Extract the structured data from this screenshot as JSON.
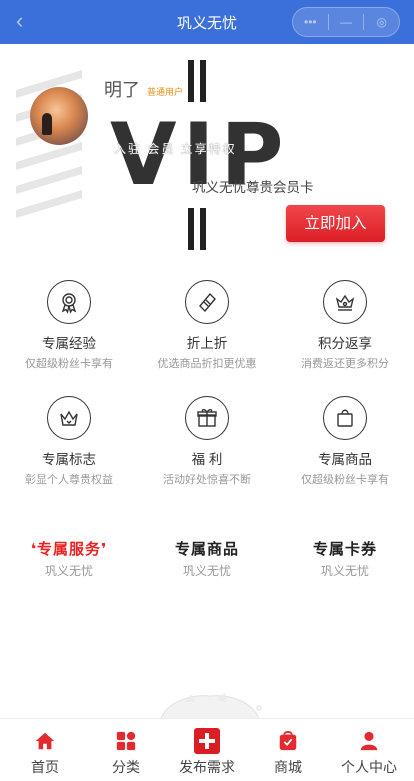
{
  "header": {
    "title": "巩义无忧"
  },
  "member": {
    "name": "明了",
    "level": "普通用户",
    "ghost_text": "入驻  会员  立享特权",
    "vip_text": "VIP",
    "card_name": "巩义无忧尊贵会员卡",
    "join_label": "立即加入"
  },
  "perks": [
    {
      "title": "专属经验",
      "desc": "仅超级粉丝卡享有",
      "icon": "medal-icon"
    },
    {
      "title": "折上折",
      "desc": "优选商品折扣更优惠",
      "icon": "ticket-icon"
    },
    {
      "title": "积分返享",
      "desc": "消费返还更多积分",
      "icon": "crown-coin-icon"
    },
    {
      "title": "专属标志",
      "desc": "彰显个人尊贵权益",
      "icon": "crown-icon"
    },
    {
      "title": "福  利",
      "desc": "活动好处惊喜不断",
      "icon": "gift-icon"
    },
    {
      "title": "专属商品",
      "desc": "仅超级粉丝卡享有",
      "icon": "shopping-bag-icon"
    }
  ],
  "services": [
    {
      "title": "专属服务",
      "sub": "巩义无忧"
    },
    {
      "title": "专属商品",
      "sub": "巩义无忧"
    },
    {
      "title": "专属卡券",
      "sub": "巩义无忧"
    }
  ],
  "tabs": [
    {
      "label": "首页",
      "icon": "home-icon"
    },
    {
      "label": "分类",
      "icon": "category-icon"
    },
    {
      "label": "发布需求",
      "icon": "publish-plus-icon"
    },
    {
      "label": "商城",
      "icon": "mall-bag-icon"
    },
    {
      "label": "个人中心",
      "icon": "user-icon"
    }
  ],
  "colors": {
    "primary": "#3b6fd9",
    "accent": "#e22a2f",
    "level_badge": "#e6901a"
  }
}
